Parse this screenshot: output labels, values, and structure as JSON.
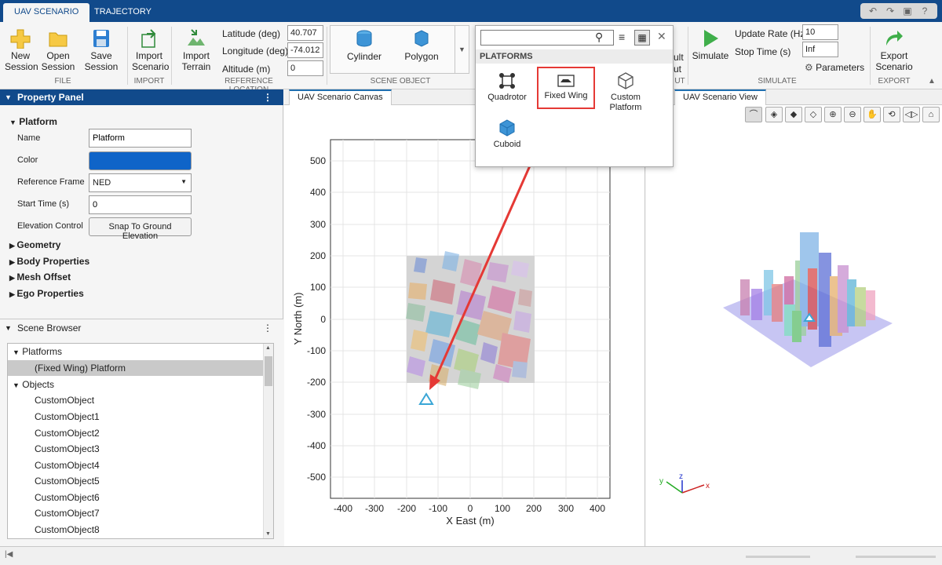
{
  "tabs": [
    {
      "label": "UAV SCENARIO"
    },
    {
      "label": "TRAJECTORY"
    }
  ],
  "toolstrip": {
    "file": {
      "new_session": "New\nSession",
      "open_session": "Open\nSession",
      "save_session": "Save\nSession",
      "section": "FILE"
    },
    "import": {
      "import_scenario": "Import\nScenario",
      "section": "IMPORT"
    },
    "reference_location": {
      "import_terrain": "Import\nTerrain",
      "latitude_label": "Latitude (deg)",
      "latitude_value": "40.707",
      "longitude_label": "Longitude (deg)",
      "longitude_value": "-74.012",
      "altitude_label": "Altitude (m)",
      "altitude_value": "0",
      "section": "REFERENCE LOCATION"
    },
    "scene_object": {
      "cylinder": "Cylinder",
      "polygon": "Polygon",
      "section": "SCENE OBJECT"
    },
    "simulate": {
      "simulate": "Simulate",
      "update_rate_label": "Update Rate (Hz)",
      "update_rate_value": "10",
      "stop_time_label": "Stop Time (s)",
      "stop_time_value": "Inf",
      "parameters": "Parameters",
      "section": "SIMULATE"
    },
    "export": {
      "export_scenario": "Export\nScenario",
      "section": "EXPORT"
    },
    "hidden_partial": {
      "line1": "ult",
      "line2": "ut",
      "section": "UT"
    }
  },
  "property_panel": {
    "title": "Property Panel",
    "platform_group": "Platform",
    "name_label": "Name",
    "name_value": "Platform",
    "color_label": "Color",
    "color_value": "#0f64c8",
    "ref_frame_label": "Reference Frame",
    "ref_frame_value": "NED",
    "start_time_label": "Start Time (s)",
    "start_time_value": "0",
    "elevation_label": "Elevation Control",
    "elevation_button": "Snap To Ground Elevation",
    "groups": [
      "Geometry",
      "Body Properties",
      "Mesh Offset",
      "Ego Properties"
    ]
  },
  "scene_browser": {
    "title": "Scene Browser",
    "platforms_label": "Platforms",
    "platform_item": "(Fixed Wing) Platform",
    "objects_label": "Objects",
    "objects": [
      "CustomObject",
      "CustomObject1",
      "CustomObject2",
      "CustomObject3",
      "CustomObject4",
      "CustomObject5",
      "CustomObject6",
      "CustomObject7",
      "CustomObject8"
    ]
  },
  "canvas": {
    "tab_label": "UAV Scenario Canvas",
    "xlabel": "X East (m)",
    "ylabel": "Y North (m)",
    "xticks": [
      "-400",
      "-300",
      "-200",
      "-100",
      "0",
      "100",
      "200",
      "300",
      "400"
    ],
    "yticks": [
      "500",
      "400",
      "300",
      "200",
      "100",
      "0",
      "-100",
      "-200",
      "-300",
      "-400",
      "-500"
    ]
  },
  "view3d": {
    "tab_label": "UAV Scenario View",
    "axes": {
      "x": "x",
      "y": "y",
      "z": "z"
    }
  },
  "popup": {
    "category": "PLATFORMS",
    "items": [
      "Quadrotor",
      "Fixed Wing",
      "Custom\nPlatform",
      "Cuboid"
    ]
  },
  "colors": {
    "accent": "#114a8b",
    "highlight": "#e53935",
    "platform_marker": "#3aa6d6"
  }
}
